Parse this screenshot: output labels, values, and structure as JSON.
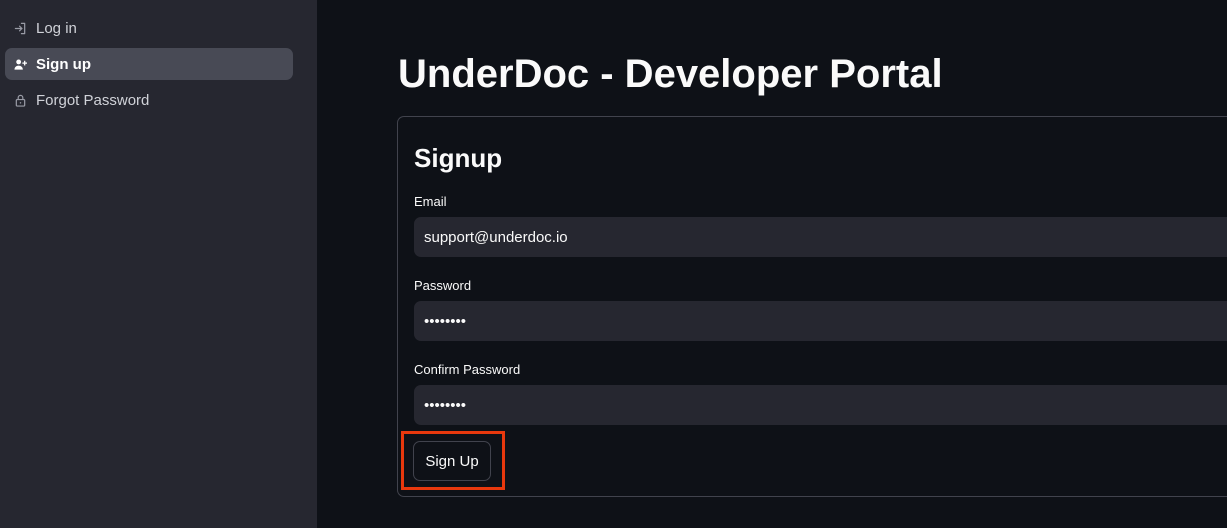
{
  "sidebar": {
    "items": [
      {
        "label": "Log in",
        "icon": "login-icon",
        "active": false
      },
      {
        "label": "Sign up",
        "icon": "add-user-icon",
        "active": true
      },
      {
        "label": "Forgot Password",
        "icon": "lock-icon",
        "active": false
      }
    ]
  },
  "main": {
    "title": "UnderDoc - Developer Portal",
    "form": {
      "title": "Signup",
      "email": {
        "label": "Email",
        "value": "support@underdoc.io"
      },
      "password": {
        "label": "Password",
        "value": "••••••••"
      },
      "confirm_password": {
        "label": "Confirm Password",
        "value": "••••••••"
      },
      "submit_label": "Sign Up"
    }
  },
  "colors": {
    "background": "#0e1117",
    "sidebar": "#262730",
    "active_item": "#484a55",
    "input": "#262730",
    "highlight": "#e8380d"
  }
}
